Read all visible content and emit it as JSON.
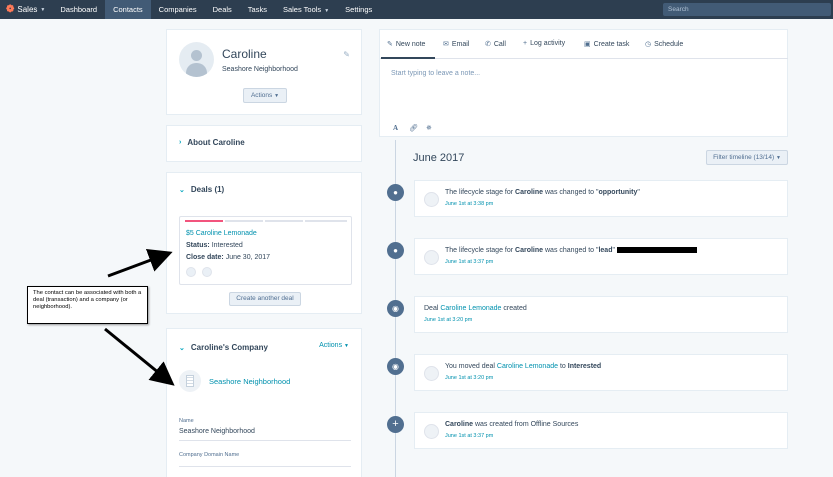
{
  "nav": {
    "brand": "Sales",
    "items": [
      {
        "label": "Dashboard",
        "active": false
      },
      {
        "label": "Contacts",
        "active": true
      },
      {
        "label": "Companies",
        "active": false
      },
      {
        "label": "Deals",
        "active": false
      },
      {
        "label": "Tasks",
        "active": false
      },
      {
        "label": "Sales Tools",
        "active": false
      },
      {
        "label": "Settings",
        "active": false
      }
    ],
    "search_placeholder": "Search"
  },
  "profile": {
    "name": "Caroline",
    "company": "Seashore Neighborhood",
    "actions_label": "Actions"
  },
  "about": {
    "title": "About Caroline"
  },
  "deals": {
    "title": "Deals (1)",
    "deal_name": "$5 Caroline Lemonade",
    "status_label": "Status:",
    "status_value": "Interested",
    "close_label": "Close date:",
    "close_value": "June 30, 2017",
    "create_label": "Create another deal"
  },
  "company": {
    "title": "Caroline's Company",
    "actions_label": "Actions",
    "name": "Seashore Neighborhood",
    "field_name_label": "Name",
    "field_name_value": "Seashore Neighborhood",
    "field_domain_label": "Company Domain Name"
  },
  "composer": {
    "tabs": [
      {
        "label": "New note",
        "icon": "pencil-icon"
      },
      {
        "label": "Email",
        "icon": "email-icon"
      },
      {
        "label": "Call",
        "icon": "phone-icon"
      },
      {
        "label": "Log activity",
        "icon": "plus-icon"
      },
      {
        "label": "Create task",
        "icon": "calendar-icon"
      },
      {
        "label": "Schedule",
        "icon": "clock-icon"
      }
    ],
    "placeholder": "Start typing to leave a note..."
  },
  "timeline": {
    "month": "June 2017",
    "filter_label": "Filter timeline (13/14)",
    "events": [
      {
        "pre": "The lifecycle stage for ",
        "b1": "Caroline",
        "mid": " was changed to \"",
        "b2": "opportunity",
        "post": "\"",
        "time": "June 1st at 3:38 pm"
      },
      {
        "pre": "The lifecycle stage for ",
        "b1": "Caroline",
        "mid": " was changed to \"",
        "b2": "lead",
        "post": "\"",
        "time": "June 1st at 3:37 pm"
      },
      {
        "pre": "Deal ",
        "link": "Caroline Lemonade",
        "post": " created",
        "time": "June 1st at 3:20 pm"
      },
      {
        "pre": "You moved deal ",
        "link": "Caroline Lemonade",
        "mid": " to ",
        "b2": "Interested",
        "time": "June 1st at 3:20 pm"
      },
      {
        "b1": "Caroline",
        "post": " was created from Offline Sources",
        "time": "June 1st at 3:37 pm"
      }
    ]
  },
  "annotation": {
    "text": "The contact can be associated with both a deal (transaction) and a company (or neighborhood)."
  },
  "colors": {
    "nav_bg": "#2d3e50",
    "link": "#0091ae",
    "accent_orange": "#ff7a59"
  }
}
